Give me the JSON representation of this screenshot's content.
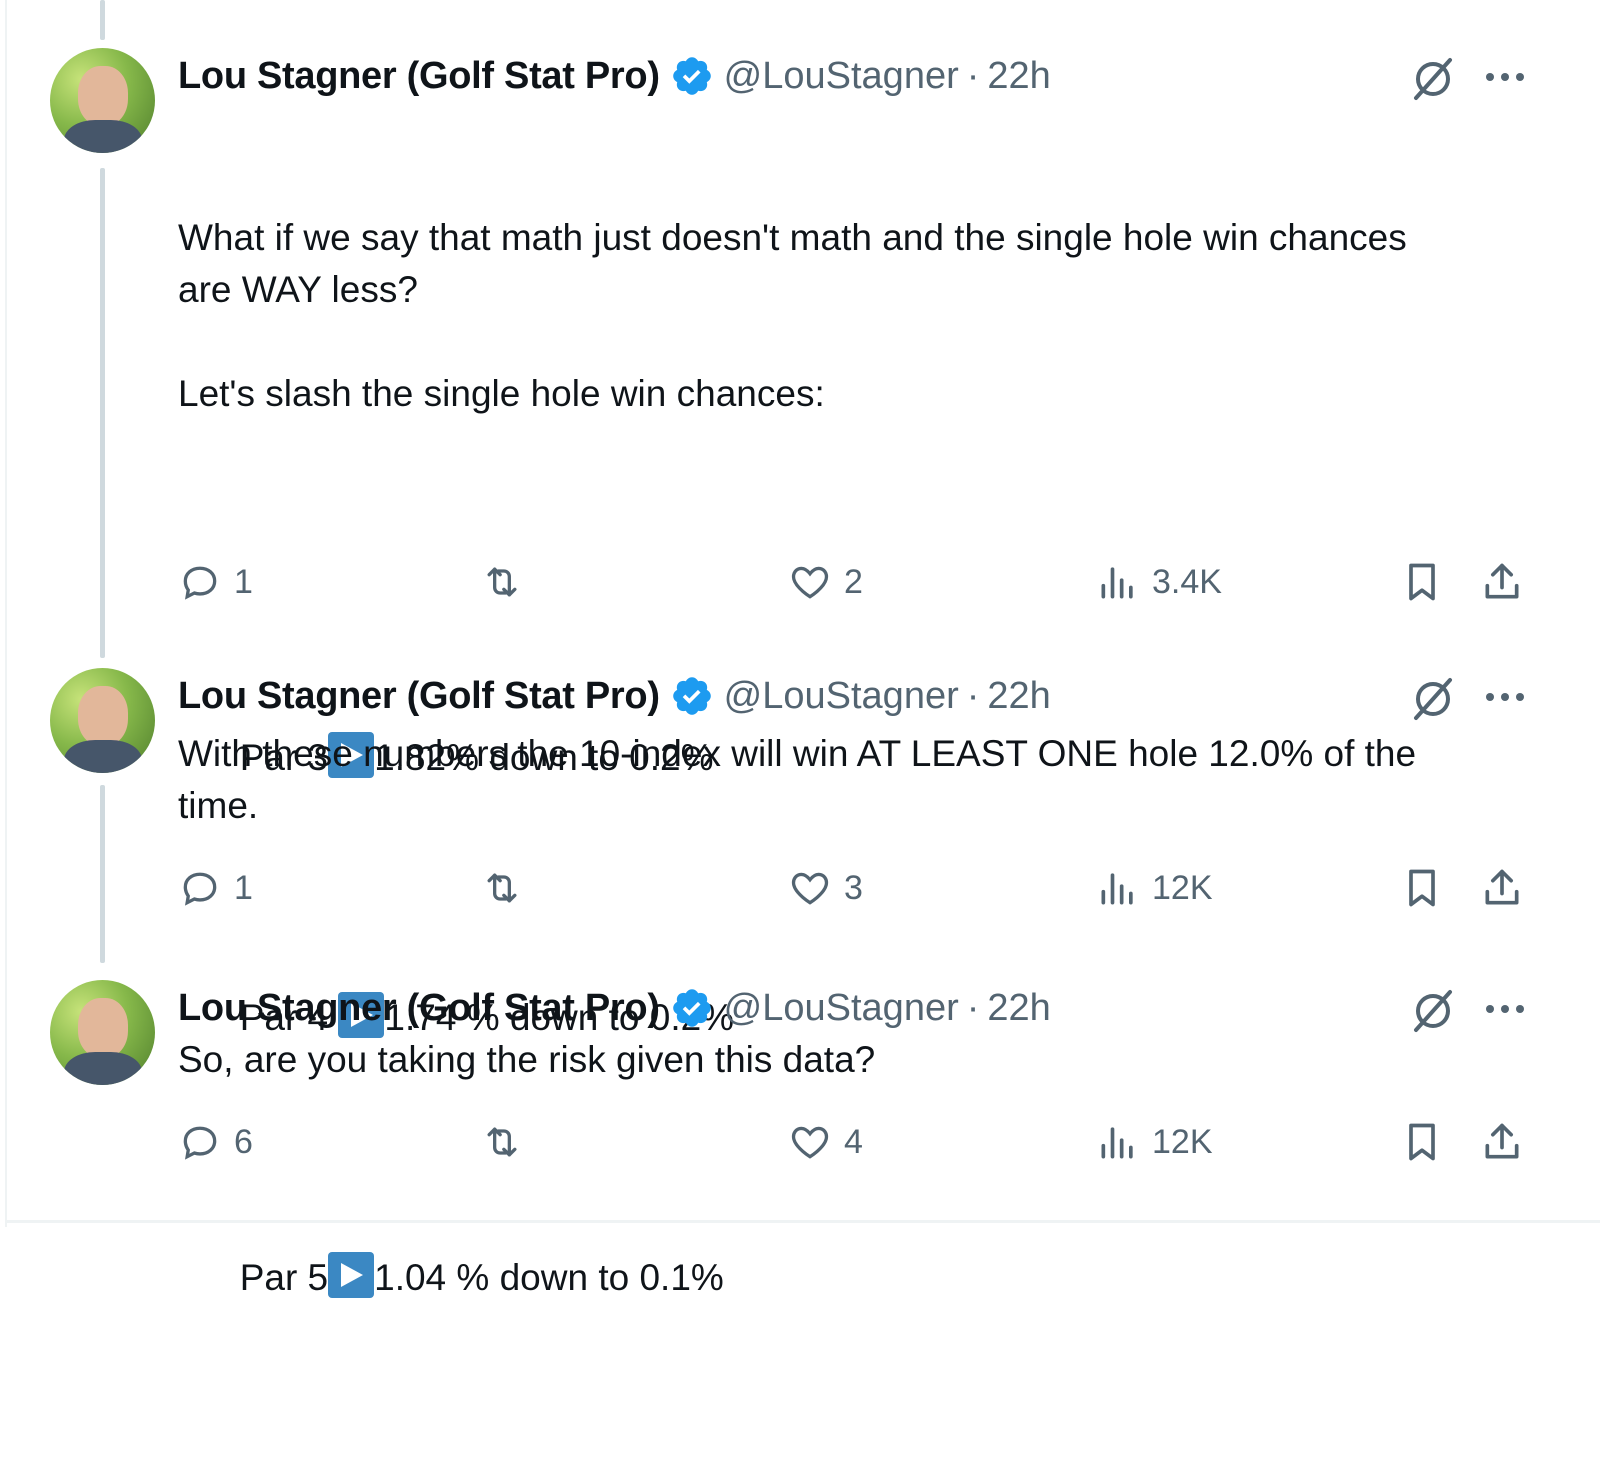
{
  "tweets": [
    {
      "author": {
        "name": "Lou Stagner (Golf Stat Pro)",
        "handle": "@LouStagner",
        "time": "22h",
        "separator": "·"
      },
      "text_intro": "What if we say that math just doesn't math and the single hole win chances\nare WAY less?\n\nLet's slash the single hole win chances:",
      "lines": [
        {
          "label": "Par 3",
          "value": "1.82% down to 0.2%"
        },
        {
          "label": "Par 4 ",
          "value": "1.74 % down to 0.2%"
        },
        {
          "label": "Par 5",
          "value": "1.04 % down to 0.1%"
        }
      ],
      "stats": {
        "replies": "1",
        "reposts": "",
        "likes": "2",
        "views": "3.4K"
      }
    },
    {
      "author": {
        "name": "Lou Stagner (Golf Stat Pro)",
        "handle": "@LouStagner",
        "time": "22h",
        "separator": "·"
      },
      "text": "With these numbers the 10-index will win AT LEAST ONE hole 12.0% of the\ntime.",
      "stats": {
        "replies": "1",
        "reposts": "",
        "likes": "3",
        "views": "12K"
      }
    },
    {
      "author": {
        "name": "Lou Stagner (Golf Stat Pro)",
        "handle": "@LouStagner",
        "time": "22h",
        "separator": "·"
      },
      "text": "So, are you taking the risk given this data?",
      "stats": {
        "replies": "6",
        "reposts": "",
        "likes": "4",
        "views": "12K"
      }
    }
  ],
  "icons": [
    "verified-badge-icon",
    "grok-icon",
    "more-icon",
    "reply-icon",
    "repost-icon",
    "like-icon",
    "views-icon",
    "bookmark-icon",
    "share-icon",
    "play-arrow-icon"
  ],
  "colors": {
    "text": "#0f1419",
    "secondary": "#536471",
    "verified": "#1d9bf0",
    "thread_line": "#cfd9de",
    "arrow_emoji": "#3b88c3"
  }
}
